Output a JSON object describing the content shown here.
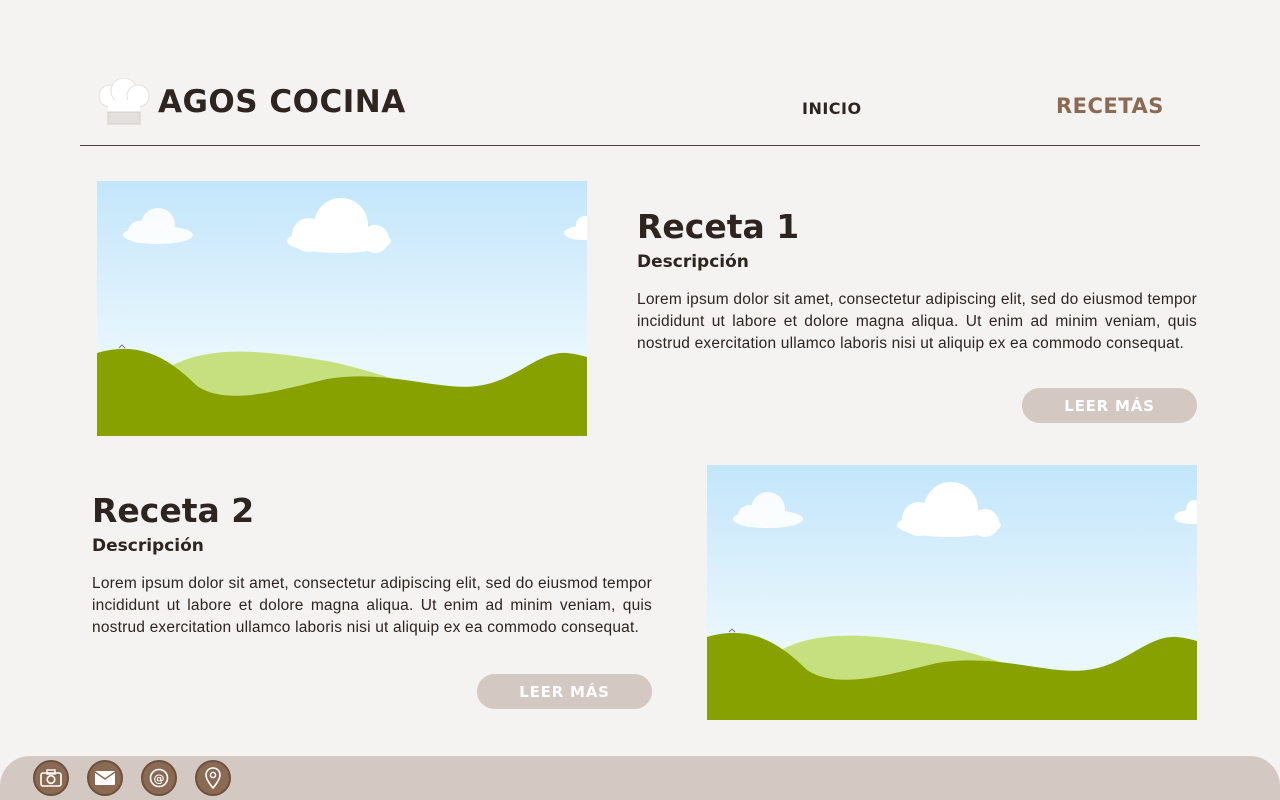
{
  "header": {
    "brand": "AGOS COCINA",
    "logo_icon": "chef-hat-icon",
    "nav": {
      "inicio": "INICIO",
      "recetas": "RECETAS"
    }
  },
  "colors": {
    "background": "#f4f3f1",
    "text": "#2e2420",
    "accent": "#8a6a53",
    "button": "#d3c8c2"
  },
  "recipes": [
    {
      "title": "Receta 1",
      "subtitle": "Descripción",
      "text": "Lorem ipsum dolor sit amet, consectetur adipiscing elit, sed do eiusmod tempor incididunt ut labore et dolore magna aliqua. Ut enim ad minim veniam, quis nostrud exercitation ullamco laboris nisi ut aliquip ex ea commodo consequat.",
      "button": "LEER MÁS"
    },
    {
      "title": "Receta 2",
      "subtitle": "Descripción",
      "text": "Lorem ipsum dolor sit amet, consectetur adipiscing elit, sed do eiusmod tempor incididunt ut labore et dolore magna aliqua. Ut enim ad minim veniam, quis nostrud exercitation ullamco laboris nisi ut aliquip ex ea commodo consequat.",
      "button": "LEER MÁS"
    }
  ],
  "footer": {
    "icons": [
      "camera-icon",
      "mail-icon",
      "at-sign-icon",
      "location-pin-icon"
    ]
  }
}
